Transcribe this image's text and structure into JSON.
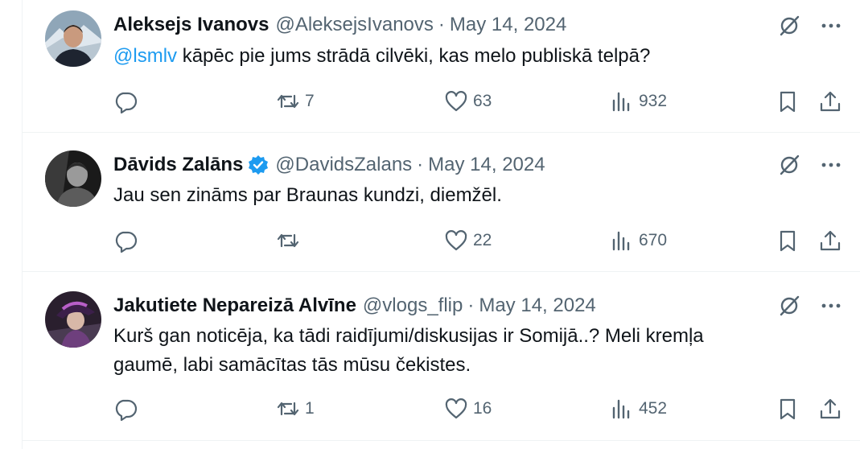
{
  "tweets": [
    {
      "author": "Aleksejs Ivanovs",
      "handle": "@AleksejsIvanovs",
      "separator": "·",
      "date": "May 14, 2024",
      "verified": false,
      "mention": "@lsmlv",
      "text": " kāpēc pie jums strādā cilvēki, kas melo publiskā telpā?",
      "retweets": "7",
      "likes": "63",
      "views": "932"
    },
    {
      "author": "Dāvids Zalāns",
      "handle": "@DavidsZalans",
      "separator": "·",
      "date": "May 14, 2024",
      "verified": true,
      "text": "Jau sen zināms par Braunas kundzi, diemžēl.",
      "retweets": "",
      "likes": "22",
      "views": "670"
    },
    {
      "author": "Jakutiete Nepareizā Alvīne",
      "handle": "@vlogs_flip",
      "separator": "·",
      "date": "May 14, 2024",
      "verified": false,
      "text_line1": "Kurš gan noticēja, ka tādi raidījumi/diskusijas ir Somijā..? Meli kremļa",
      "text_line2": "gaumē, labi samācītas tās mūsu čekistes.",
      "retweets": "1",
      "likes": "16",
      "views": "452"
    }
  ],
  "icons": {
    "reply": "reply-icon",
    "retweet": "retweet-icon",
    "like": "heart-icon",
    "views": "views-icon",
    "bookmark": "bookmark-icon",
    "share": "share-icon",
    "grok": "grok-icon",
    "more": "more-icon",
    "verified": "verified-badge-icon"
  },
  "colors": {
    "text": "#0f1419",
    "secondary": "#536471",
    "accent": "#1d9bf0",
    "divider": "#eff3f4"
  }
}
